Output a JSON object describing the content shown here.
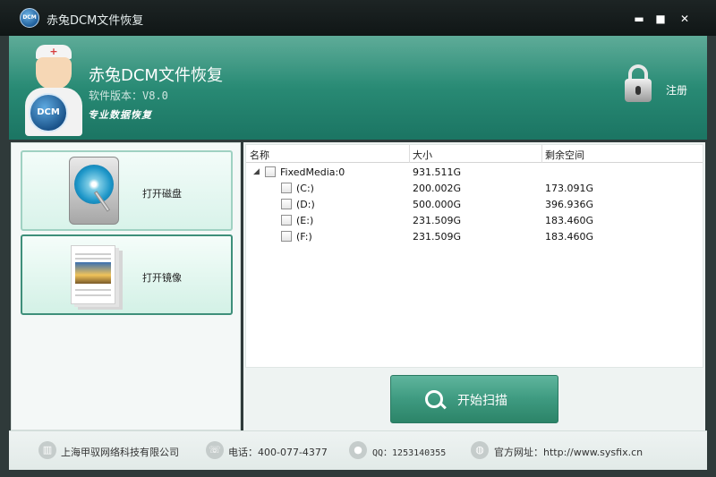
{
  "window": {
    "title": "赤兔DCM文件恢复",
    "logo_text": "DCM",
    "controls": {
      "minimize": "▬",
      "maximize": "■",
      "close": "✕"
    }
  },
  "header": {
    "app_title": "赤兔DCM文件恢复",
    "version": "软件版本：V8.0",
    "slogan": "专业数据恢复",
    "mascot_badge": "DCM",
    "register_label": "注册",
    "register_icon": "lock-icon"
  },
  "actions": [
    {
      "label": "打开磁盘",
      "icon": "hard-disk-icon"
    },
    {
      "label": "打开镜像",
      "icon": "disk-image-icon"
    }
  ],
  "tree": {
    "columns": [
      "名称",
      "大小",
      "剩余空间"
    ],
    "root": {
      "name": "FixedMedia:0",
      "size": "931.511G",
      "free": ""
    },
    "children": [
      {
        "name": "(C:)",
        "size": "200.002G",
        "free": "173.091G"
      },
      {
        "name": "(D:)",
        "size": "500.000G",
        "free": "396.936G"
      },
      {
        "name": "(E:)",
        "size": "231.509G",
        "free": "183.460G"
      },
      {
        "name": "(F:)",
        "size": "231.509G",
        "free": "183.460G"
      }
    ]
  },
  "scan_button": {
    "label": "开始扫描",
    "icon": "search-icon"
  },
  "footer": {
    "company": "上海甲驭网络科技有限公司",
    "phone": "电话：400-077-4377",
    "qq": "QQ：1253140355",
    "website": "官方网址：http://www.sysfix.cn"
  },
  "colors": {
    "accent": "#2a8c76",
    "button": "#3e9a80",
    "titlebar": "#101616"
  }
}
